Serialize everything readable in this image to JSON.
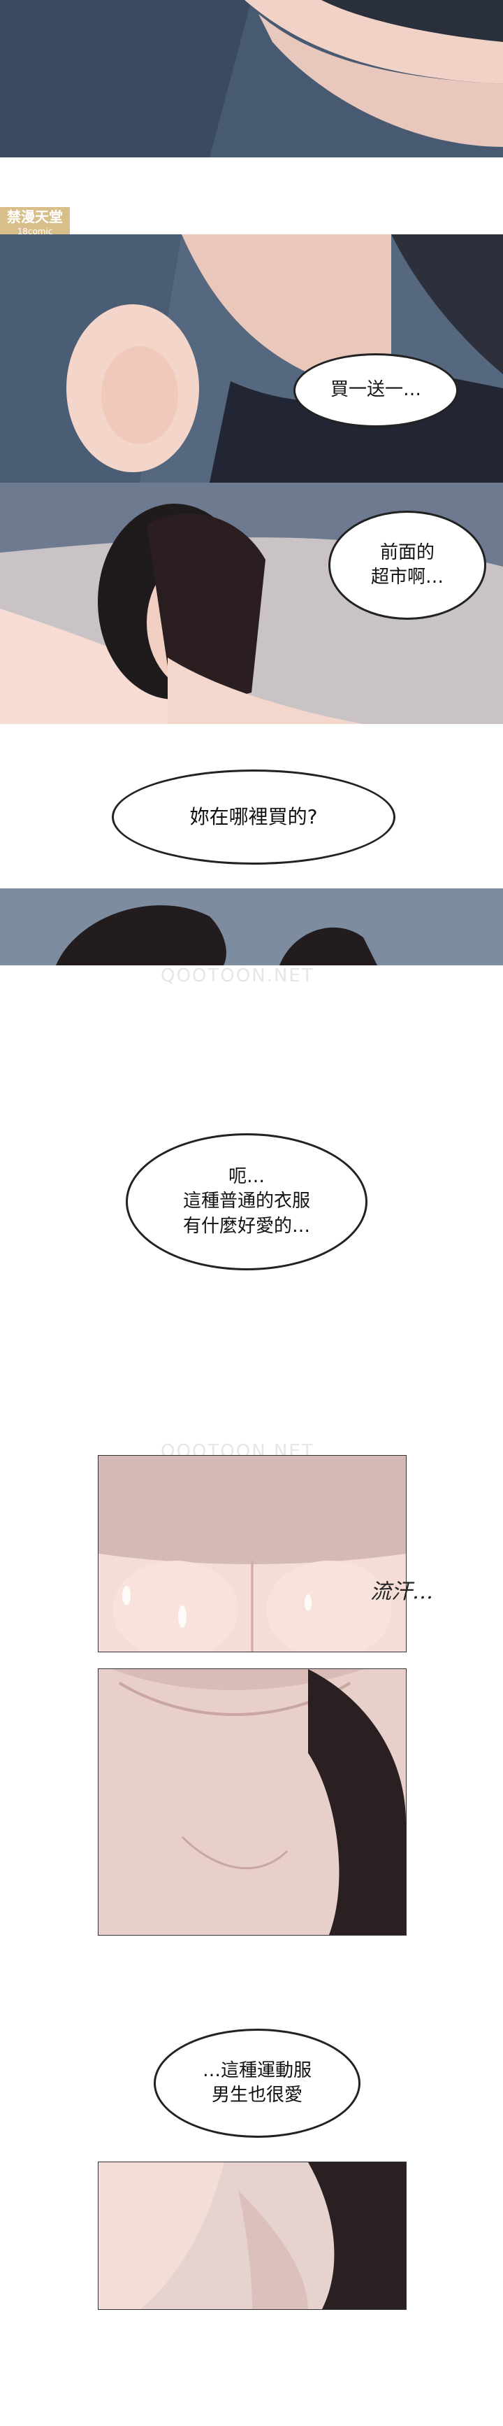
{
  "watermarks": {
    "site_badge": "禁漫天堂",
    "site_sub": "18comic",
    "qootoon_1": "QOOTOON.NET",
    "qootoon_2": "QOOTOON.NET"
  },
  "dialogue": {
    "line_1": "買一送一…",
    "line_2": "前面的\n超市啊…",
    "line_3": "妳在哪裡買的?",
    "line_4": "呃…\n這種普通的衣服\n有什麼好愛的…",
    "sfx_1": "流汗…",
    "line_5": "…這種運動服\n男生也很愛"
  }
}
